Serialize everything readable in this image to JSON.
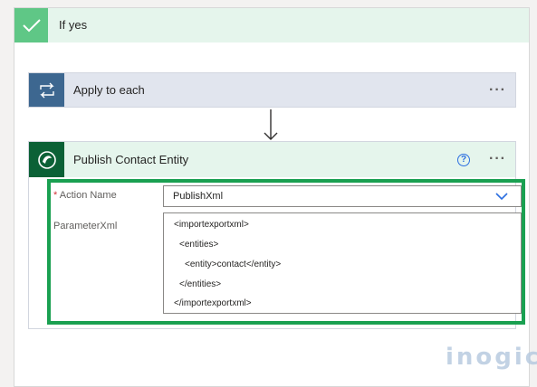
{
  "if_yes": {
    "label": "If yes",
    "icon": "checkmark-icon"
  },
  "apply_each": {
    "label": "Apply to each",
    "icon": "loop-icon",
    "more": "···"
  },
  "publish": {
    "title": "Publish Contact Entity",
    "icon": "dataverse-icon",
    "help": "?",
    "more": "···",
    "action_name": {
      "required": "*",
      "label": "Action Name",
      "value": "PublishXml"
    },
    "parameter_xml": {
      "label": "ParameterXml",
      "lines": [
        "<importexportxml>",
        "<entities>",
        "<entity>contact</entity>",
        "</entities>",
        "</importexportxml>"
      ]
    }
  },
  "watermark": {
    "text": "inogic"
  },
  "colors": {
    "if_yes_accent": "#5fc786",
    "loop_accent": "#3d6790",
    "dataverse_accent": "#0b6136",
    "highlight": "#1aa051"
  }
}
